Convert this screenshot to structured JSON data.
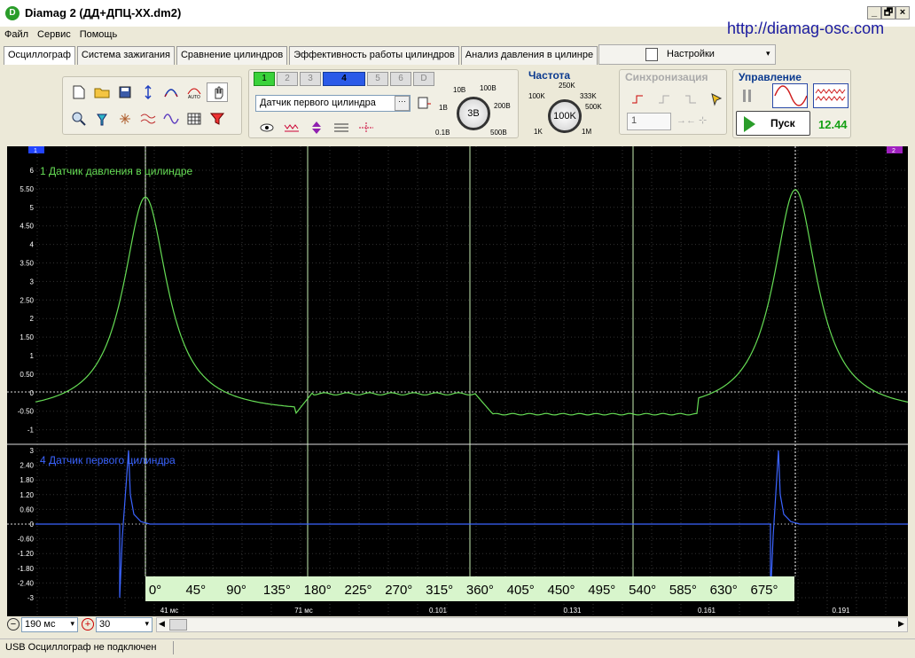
{
  "window": {
    "title": "Diamag 2 (ДД+ДПЦ-XX.dm2)",
    "url": "http://diamag-osc.com",
    "controls": [
      "_",
      "🗗",
      "×"
    ]
  },
  "menu": [
    "Файл",
    "Сервис",
    "Помощь"
  ],
  "tabs": [
    {
      "label": "Осциллограф",
      "active": true
    },
    {
      "label": "Система зажигания",
      "active": false
    },
    {
      "label": "Сравнение цилиндров",
      "active": false
    },
    {
      "label": "Эффективность работы цилиндров",
      "active": false
    },
    {
      "label": "Анализ давления в цилинре",
      "active": false
    }
  ],
  "settings_label": "Настройки",
  "channels": {
    "buttons": [
      "1",
      "2",
      "3",
      "4",
      "5",
      "6",
      "D"
    ],
    "selected_sensor": "Датчик первого цилиндра"
  },
  "voltage_knob": {
    "value": "3В",
    "labels": [
      "10В",
      "100В",
      "1В",
      "200В",
      "0.1В",
      "500В"
    ]
  },
  "frequency": {
    "title": "Частота",
    "value": "100K",
    "labels": [
      "250K",
      "100K",
      "333K",
      "500K",
      "1K",
      "1M"
    ]
  },
  "sync": {
    "title": "Синхронизация",
    "value": "1"
  },
  "control": {
    "title": "Управление",
    "start_label": "Пуск",
    "reading": "12.44",
    "reading_color": "#14a014"
  },
  "scope": {
    "ch1_label": "1 Датчик давления в цилиндре",
    "ch4_label": "4 Датчик первого цилиндра",
    "ch1_color": "#66dd55",
    "ch4_color": "#3b64ff",
    "ch1_ticks": [
      "6",
      "5.50",
      "5",
      "4.50",
      "4",
      "3.50",
      "3",
      "2.50",
      "2",
      "1.50",
      "1",
      "0.50",
      "0",
      "-0.50",
      "-1"
    ],
    "ch4_ticks": [
      "3",
      "2.40",
      "1.80",
      "1.20",
      "0.60",
      "0",
      "-0.60",
      "-1.20",
      "-1.80",
      "-2.40",
      "-3"
    ],
    "degrees": [
      "0°",
      "45°",
      "90°",
      "135°",
      "180°",
      "225°",
      "270°",
      "315°",
      "360°",
      "405°",
      "450°",
      "495°",
      "540°",
      "585°",
      "630°",
      "675°"
    ],
    "time_labels": [
      "41 мс",
      "71 мс",
      "0.101",
      "0.131",
      "0.161",
      "0.191"
    ],
    "marker_left": "1",
    "marker_right": "2"
  },
  "bottom": {
    "timebase": "190",
    "timebase_unit": "мс",
    "count": "30"
  },
  "status_text": "USB Осциллограф не подключен"
}
